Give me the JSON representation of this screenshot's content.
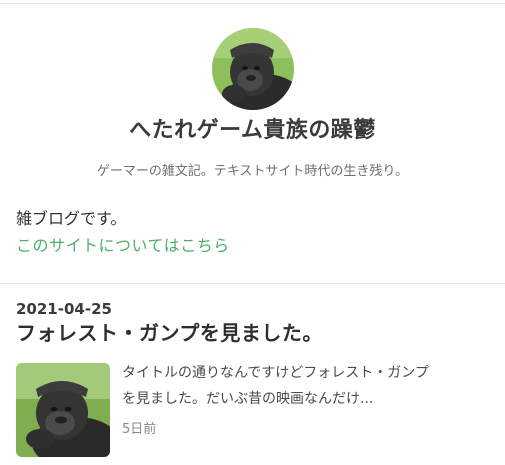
{
  "header": {
    "title": "へたれゲーム貴族の躁鬱",
    "description": "ゲーマーの雑文記。テキストサイト時代の生き残り。",
    "intro": "雑ブログです。",
    "about_link": "このサイトについてはこちら"
  },
  "entries": [
    {
      "date": "2021-04-25",
      "title": "フォレスト・ガンプを見ました。",
      "excerpt_line1": "タイトルの通りなんですけどフォレスト・ガンプ",
      "excerpt_line2": "を見ました。だいぶ昔の映画なんだけ...",
      "time_ago": "5日前",
      "thumbnail_icon": "gorilla-photo"
    }
  ],
  "avatar_icon": "gorilla-photo",
  "colors": {
    "link": "#4caf6a",
    "title": "#3a3a3a",
    "muted": "#8a8a8a"
  }
}
